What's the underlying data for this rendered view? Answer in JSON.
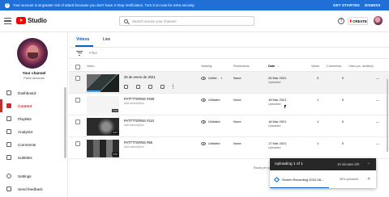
{
  "banner": {
    "icon": "warning-icon",
    "message": "Your account is at greater risk of attack because you don't have 2-Step Verification. Turn it on now for extra security",
    "get_started": "GET STARTED",
    "dismiss": "DISMISS",
    "bg_color": "#1f6fd6"
  },
  "header": {
    "logo_text": "Studio",
    "search_placeholder": "Search across your channel",
    "help_glyph": "?",
    "create_label": "CREATE",
    "accent": "#ff0000"
  },
  "sidebar": {
    "channel_title": "Your channel",
    "channel_name": "Pablo Almansa",
    "active_color": "#c4302b",
    "items": [
      {
        "label": "Dashboard",
        "icon": "dashboard-icon"
      },
      {
        "label": "Content",
        "icon": "content-icon",
        "active": true
      },
      {
        "label": "Playlists",
        "icon": "playlists-icon"
      },
      {
        "label": "Analytics",
        "icon": "analytics-icon"
      },
      {
        "label": "Comments",
        "icon": "comments-icon"
      },
      {
        "label": "Subtitles",
        "icon": "subtitles-icon"
      },
      {
        "label": "Settings",
        "icon": "gear-icon"
      },
      {
        "label": "Send feedback",
        "icon": "feedback-icon"
      }
    ]
  },
  "tabs": {
    "videos": "Videos",
    "live": "Live"
  },
  "filter": {
    "label": "Filter"
  },
  "columns": {
    "video": "Video",
    "visibility": "Visibility",
    "restrictions": "Restrictions",
    "date": "Date",
    "date_sort": "↓",
    "views": "Views",
    "comments": "Comments",
    "likes": "Likes (vs. dislikes)"
  },
  "rows": [
    {
      "title": "26 de enero de 2021",
      "description": "",
      "duration": "",
      "visibility": "Unlist...",
      "restrictions": "None",
      "date": "26 Mar 2021",
      "date_status": "Uploaded",
      "views": "0",
      "comments": "0",
      "likes": "—"
    },
    {
      "title": "PATTTTERNS #209",
      "description": "Add description",
      "duration": "0:06",
      "visibility": "Unlisted",
      "restrictions": "None",
      "date": "18 Mar 2021",
      "date_status": "Uploaded",
      "views": "1",
      "comments": "0",
      "likes": "—"
    },
    {
      "title": "PATTTTERNS #110",
      "description": "Add description",
      "duration": "0:07",
      "visibility": "Unlisted",
      "restrictions": "None",
      "date": "18 Mar 2021",
      "date_status": "Uploaded",
      "views": "1",
      "comments": "0",
      "likes": "—"
    },
    {
      "title": "PATTTTERNS #56",
      "description": "Add description",
      "duration": "0:06",
      "visibility": "Unlisted",
      "restrictions": "None",
      "date": "17 Mar 2021",
      "date_status": "Uploaded",
      "views": "1",
      "comments": "0",
      "likes": "—"
    }
  ],
  "footer": {
    "rows_per_page": "Rows per page:"
  },
  "upload": {
    "title": "Uploading 1 of 1",
    "time_left": "15 minutes left",
    "chevron": "^",
    "file_name": "Screen Recording 2022-08-...",
    "percent": "56% uploaded",
    "progress_percent": 56,
    "close": "✕"
  }
}
